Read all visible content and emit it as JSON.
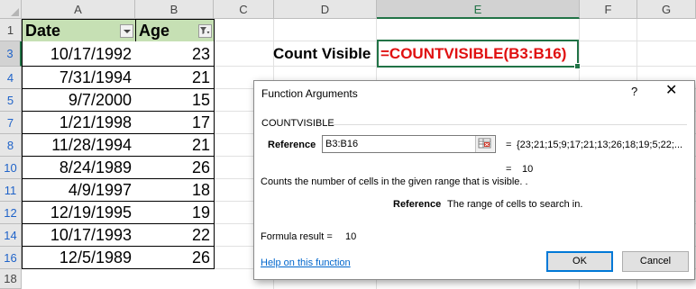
{
  "columns": [
    "A",
    "B",
    "C",
    "D",
    "E",
    "F",
    "G"
  ],
  "rows": [
    "1",
    "3",
    "4",
    "5",
    "7",
    "8",
    "10",
    "11",
    "12",
    "14",
    "16",
    "18"
  ],
  "table": {
    "headers": [
      "Date",
      "Age"
    ],
    "data": [
      {
        "date": "10/17/1992",
        "age": "23"
      },
      {
        "date": "7/31/1994",
        "age": "21"
      },
      {
        "date": "9/7/2000",
        "age": "15"
      },
      {
        "date": "1/21/1998",
        "age": "17"
      },
      {
        "date": "11/28/1994",
        "age": "21"
      },
      {
        "date": "8/24/1989",
        "age": "26"
      },
      {
        "date": "4/9/1997",
        "age": "18"
      },
      {
        "date": "12/19/1995",
        "age": "19"
      },
      {
        "date": "10/17/1993",
        "age": "22"
      },
      {
        "date": "12/5/1989",
        "age": "26"
      }
    ]
  },
  "count_label": "Count Visible",
  "formula": "=COUNTVISIBLE(B3:B16)",
  "dialog": {
    "title": "Function Arguments",
    "help_symbol": "?",
    "close_symbol": "✕",
    "function_name": "COUNTVISIBLE",
    "arg_label": "Reference",
    "arg_value": "B3:B16",
    "equals": "=",
    "arg_result": "{23;21;15;9;17;21;13;26;18;19;5;22;...",
    "result": "10",
    "description": "Counts the number of cells in the given range that is visible. .",
    "arg_desc_name": "Reference",
    "arg_desc": "The range of cells to search in.",
    "formula_result_label": "Formula result =",
    "formula_result_value": "10",
    "help_link": "Help on this function",
    "ok_label": "OK",
    "cancel_label": "Cancel"
  },
  "colors": {
    "header_fill": "#c6e0b4",
    "formula_text": "#e01010",
    "selection": "#217346",
    "filtered_row_number": "#1f63c9"
  }
}
